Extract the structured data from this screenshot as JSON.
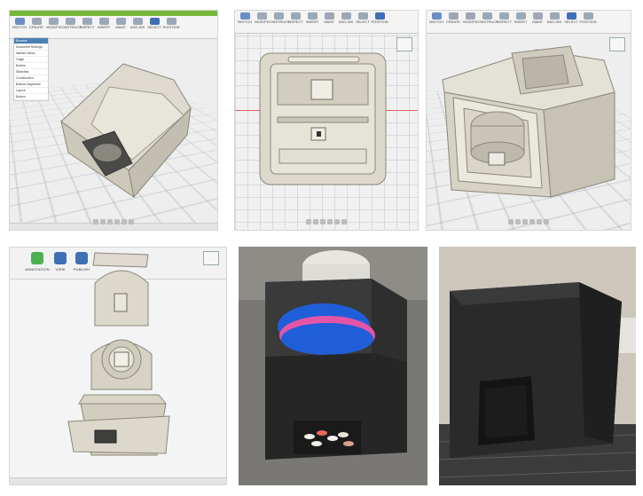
{
  "panels": {
    "cad_view_1": {
      "top_banner": "",
      "toolbar": [
        "SKETCH",
        "CREATE",
        "MODIFY",
        "CONSTRUCT",
        "INSPECT",
        "INSERT",
        "MAKE",
        "ADD-INS",
        "SELECT",
        "POSITION"
      ],
      "browser_items": [
        "Browser",
        "Document Settings",
        "Named Views",
        "Origin",
        "Bodies",
        "Sketches",
        "Construction",
        "Bottom Dispenser",
        "Layout",
        "Bodies"
      ]
    },
    "cad_view_2": {
      "toolbar": [
        "SKETCH",
        "MODIFY",
        "CONSTRUCT",
        "INSPECT",
        "INSERT",
        "MAKE",
        "ADD-INS",
        "SELECT",
        "POSITION"
      ]
    },
    "cad_view_3": {
      "toolbar": [
        "SKETCH",
        "CREATE",
        "MODIFY",
        "CONSTRUCT",
        "INSPECT",
        "INSERT",
        "MAKE",
        "ADD-INS",
        "SELECT",
        "POSITION"
      ]
    },
    "cad_view_4": {
      "tools": [
        {
          "label": "ANNOTATION",
          "icon": "annotation-icon",
          "color": "#4caf50"
        },
        {
          "label": "VIEW",
          "icon": "view-icon",
          "color": "#3f6fb5"
        },
        {
          "label": "PUBLISH",
          "icon": "publish-icon",
          "color": "#3f6fb5"
        }
      ]
    }
  },
  "colors": {
    "model_fill": "#d8d4c6",
    "model_edge": "#8b877a",
    "print_black": "#2a2a2a",
    "filament_blue": "#1f5ed8",
    "filament_pink": "#e455a8",
    "cad_green": "#77b83a"
  }
}
